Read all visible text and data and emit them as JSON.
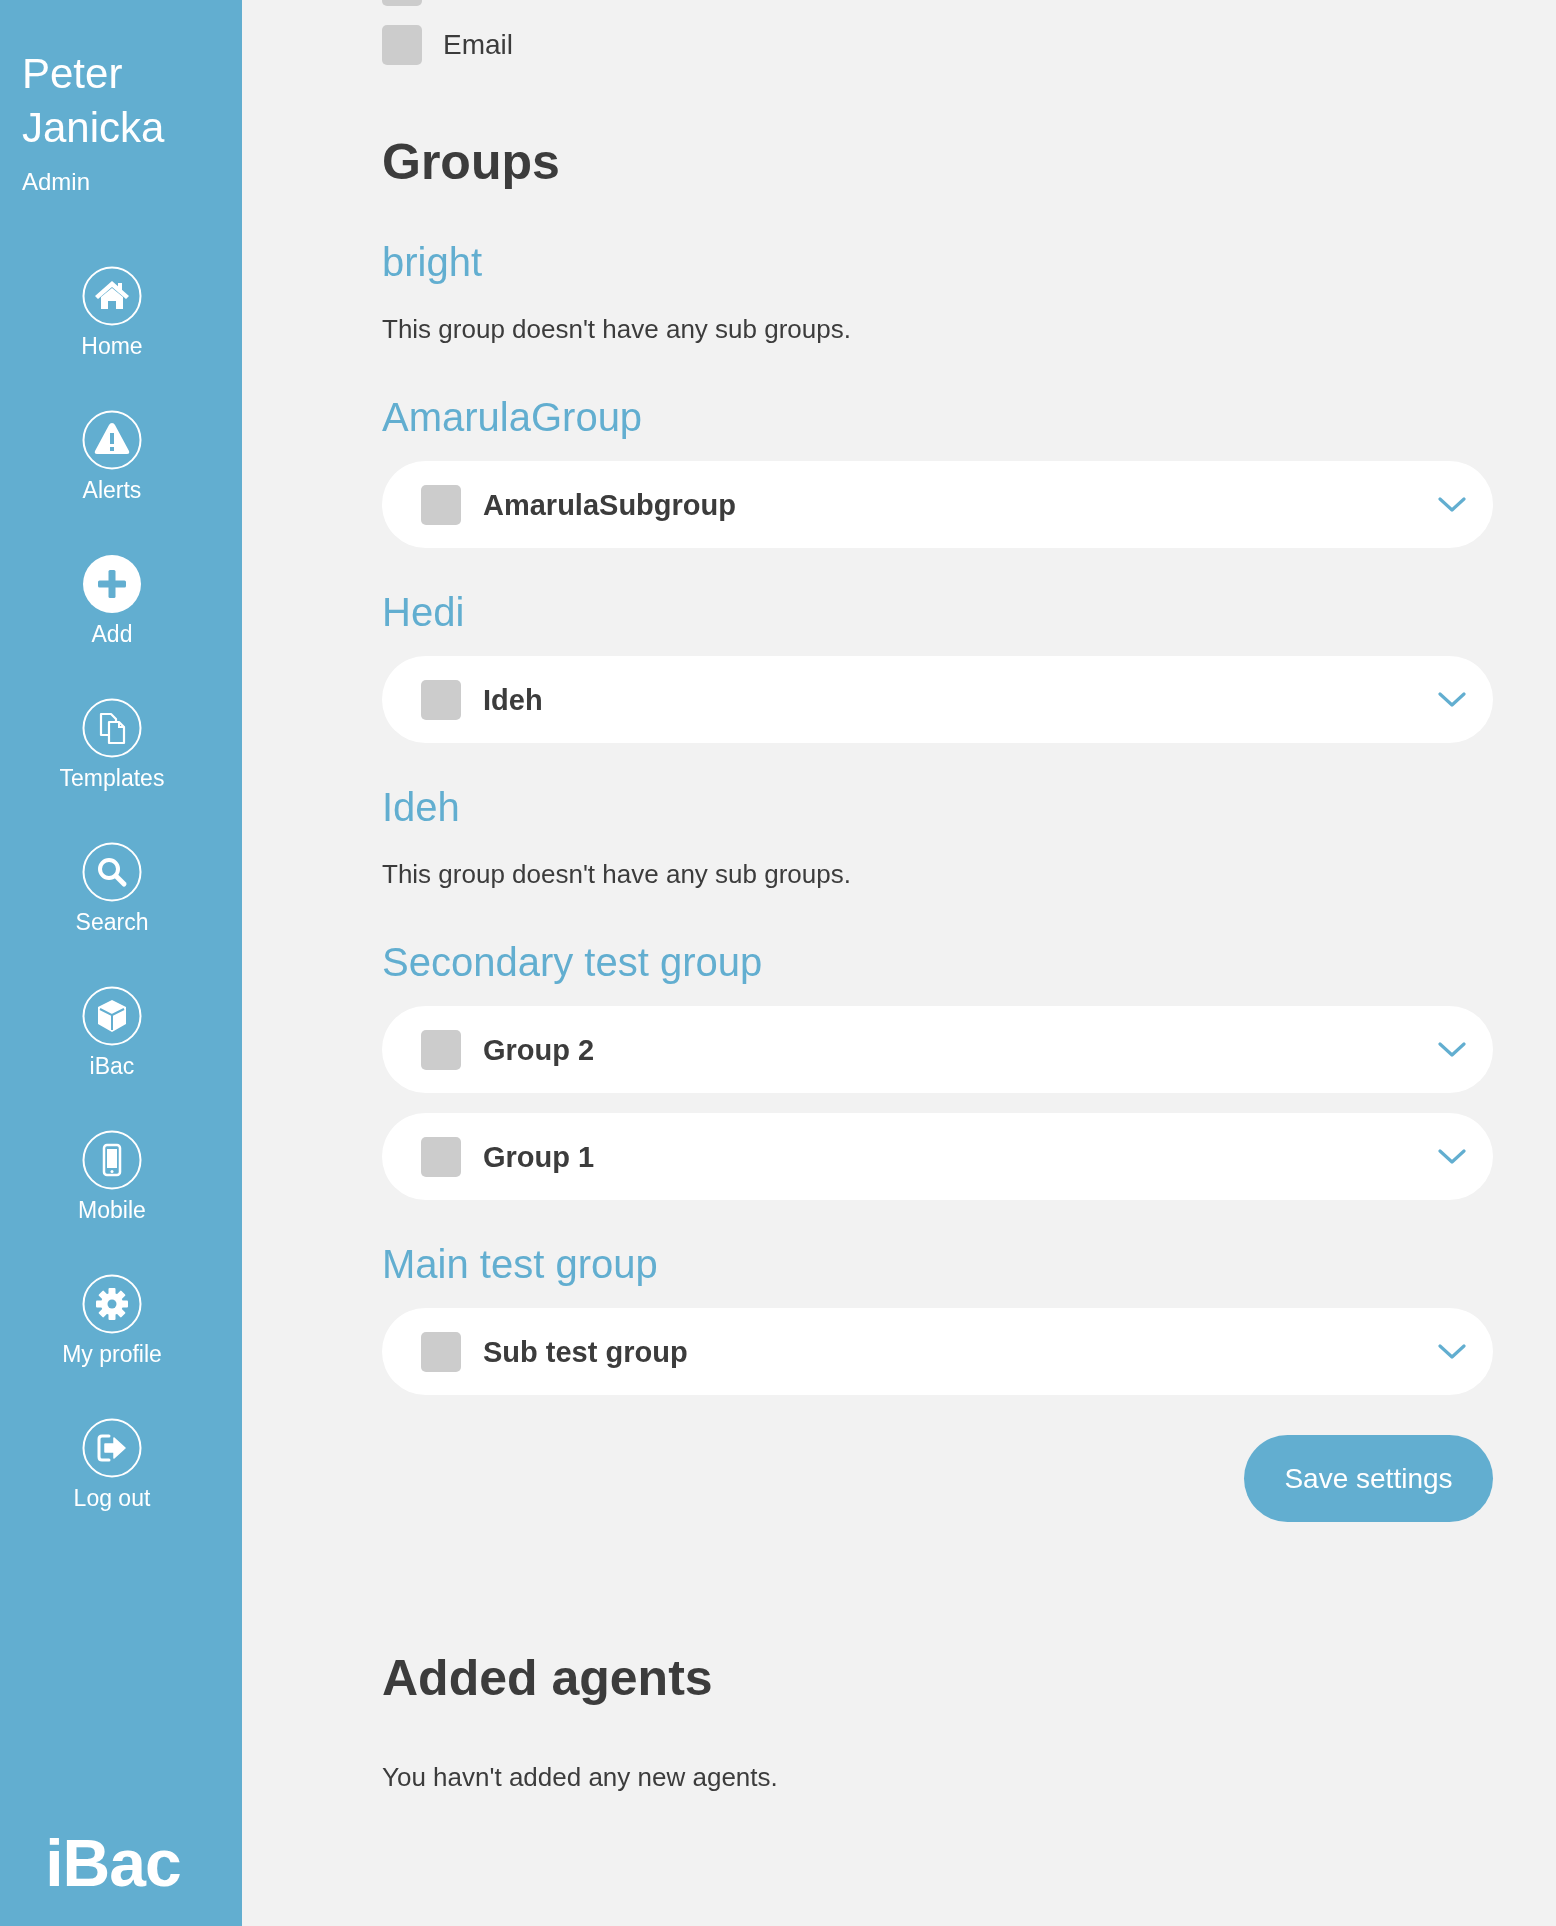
{
  "sidebar": {
    "user_name": "Peter Janicka",
    "role": "Admin",
    "nav_items": [
      {
        "label": "Home"
      },
      {
        "label": "Alerts"
      },
      {
        "label": "Add"
      },
      {
        "label": "Templates"
      },
      {
        "label": "Search"
      },
      {
        "label": "iBac"
      },
      {
        "label": "Mobile"
      },
      {
        "label": "My profile"
      },
      {
        "label": "Log out"
      }
    ],
    "logo": "iBac"
  },
  "notification_options": [
    {
      "checked": false
    },
    {
      "label": "Email",
      "checked": false
    }
  ],
  "groups_section": {
    "title": "Groups",
    "groups": [
      {
        "name": "bright",
        "description": "This group doesn't have any sub groups."
      },
      {
        "name": "AmarulaGroup",
        "subgroups": [
          {
            "name": "AmarulaSubgroup",
            "checked": false,
            "expanded": false
          }
        ]
      },
      {
        "name": "Hedi",
        "subgroups": [
          {
            "name": "Ideh",
            "checked": false,
            "expanded": false
          }
        ]
      },
      {
        "name": "Ideh",
        "description": "This group doesn't have any sub groups."
      },
      {
        "name": "Secondary test group",
        "subgroups": [
          {
            "name": "Group 2",
            "checked": false,
            "expanded": false
          },
          {
            "name": "Group 1",
            "checked": false,
            "expanded": false
          }
        ]
      },
      {
        "name": "Main test group",
        "subgroups": [
          {
            "name": "Sub test group",
            "checked": false,
            "expanded": false
          }
        ]
      }
    ]
  },
  "save_button": "Save settings",
  "added_agents": {
    "title": "Added agents",
    "message": "You havn't added any new agents."
  }
}
